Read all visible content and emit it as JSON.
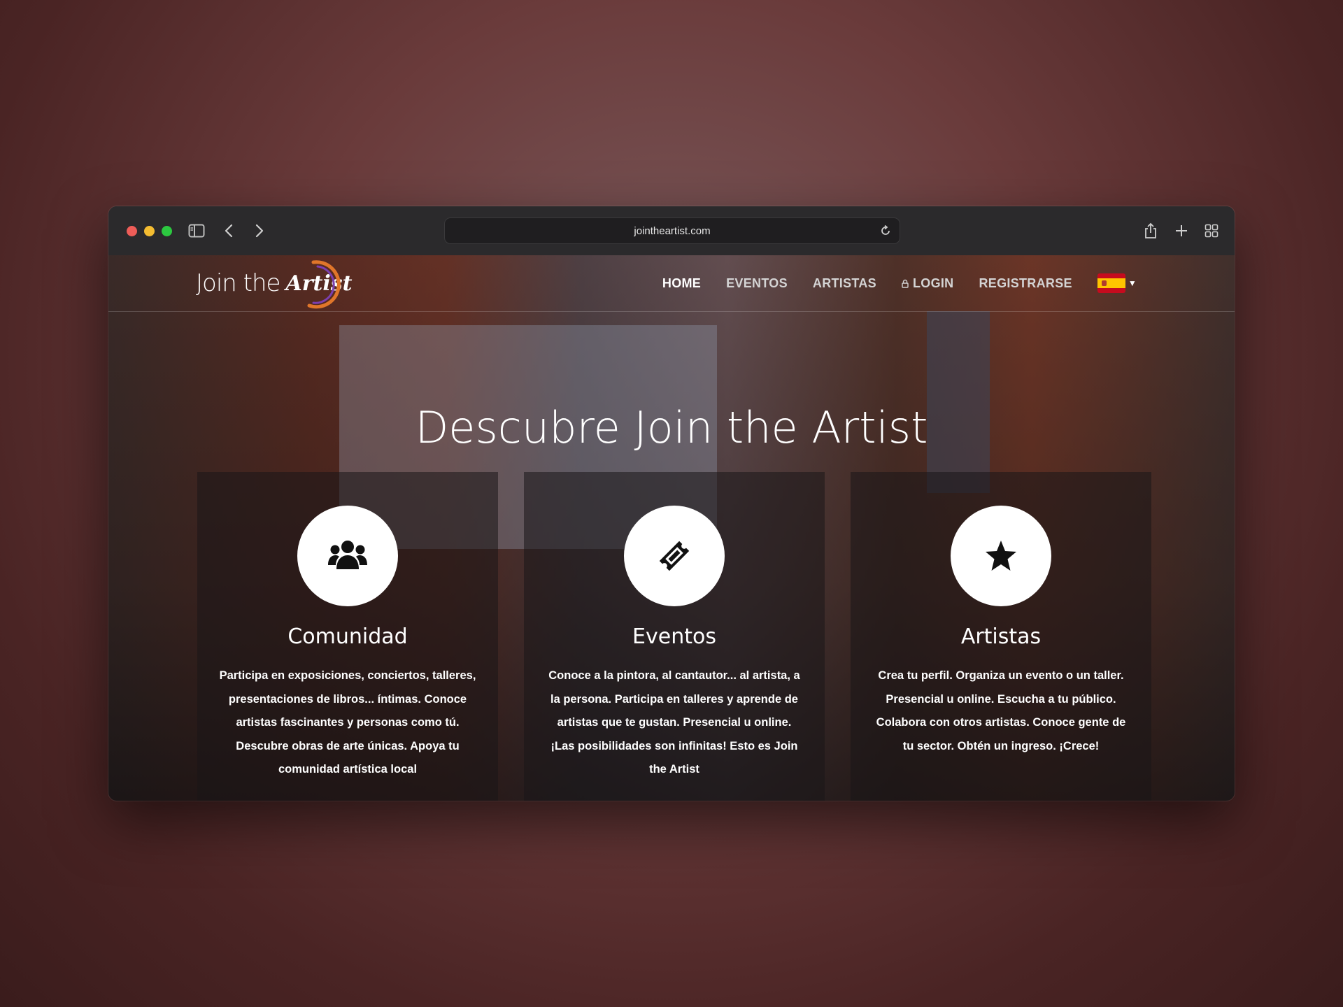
{
  "browser": {
    "url": "jointheartist.com",
    "icons": [
      "sidebar-icon",
      "back-icon",
      "forward-icon",
      "reload-icon",
      "share-icon",
      "new-tab-icon",
      "tab-overview-icon"
    ]
  },
  "site": {
    "logo": {
      "text": "Join the",
      "script": "Artist"
    },
    "nav": {
      "home": "HOME",
      "eventos": "EVENTOS",
      "artistas": "ARTISTAS",
      "login": "LOGIN",
      "registrarse": "REGISTRARSE"
    },
    "language": "es",
    "hero_title": "Descubre Join the Artist",
    "cards": [
      {
        "icon": "users-icon",
        "title": "Comunidad",
        "text": "Participa en exposiciones, conciertos, talleres, presentaciones de libros... íntimas. Conoce artistas fascinantes y personas como tú. Descubre obras de arte únicas. Apoya tu comunidad artística local"
      },
      {
        "icon": "ticket-icon",
        "title": "Eventos",
        "text": "Conoce a la pintora, al cantautor... al artista, a la persona. Participa en talleres y aprende de artistas que te gustan. Presencial u online. ¡Las posibilidades son infinitas! Esto es Join the Artist"
      },
      {
        "icon": "star-icon",
        "title": "Artistas",
        "text": "Crea tu perfil. Organiza un evento o un taller. Presencial u online. Escucha a tu público. Colabora con otros artistas. Conoce gente de tu sector. Obtén un ingreso. ¡Crece!"
      }
    ]
  },
  "colors": {
    "accent_logo": "#e0762a",
    "logo_purple": "#7b3fb0"
  }
}
